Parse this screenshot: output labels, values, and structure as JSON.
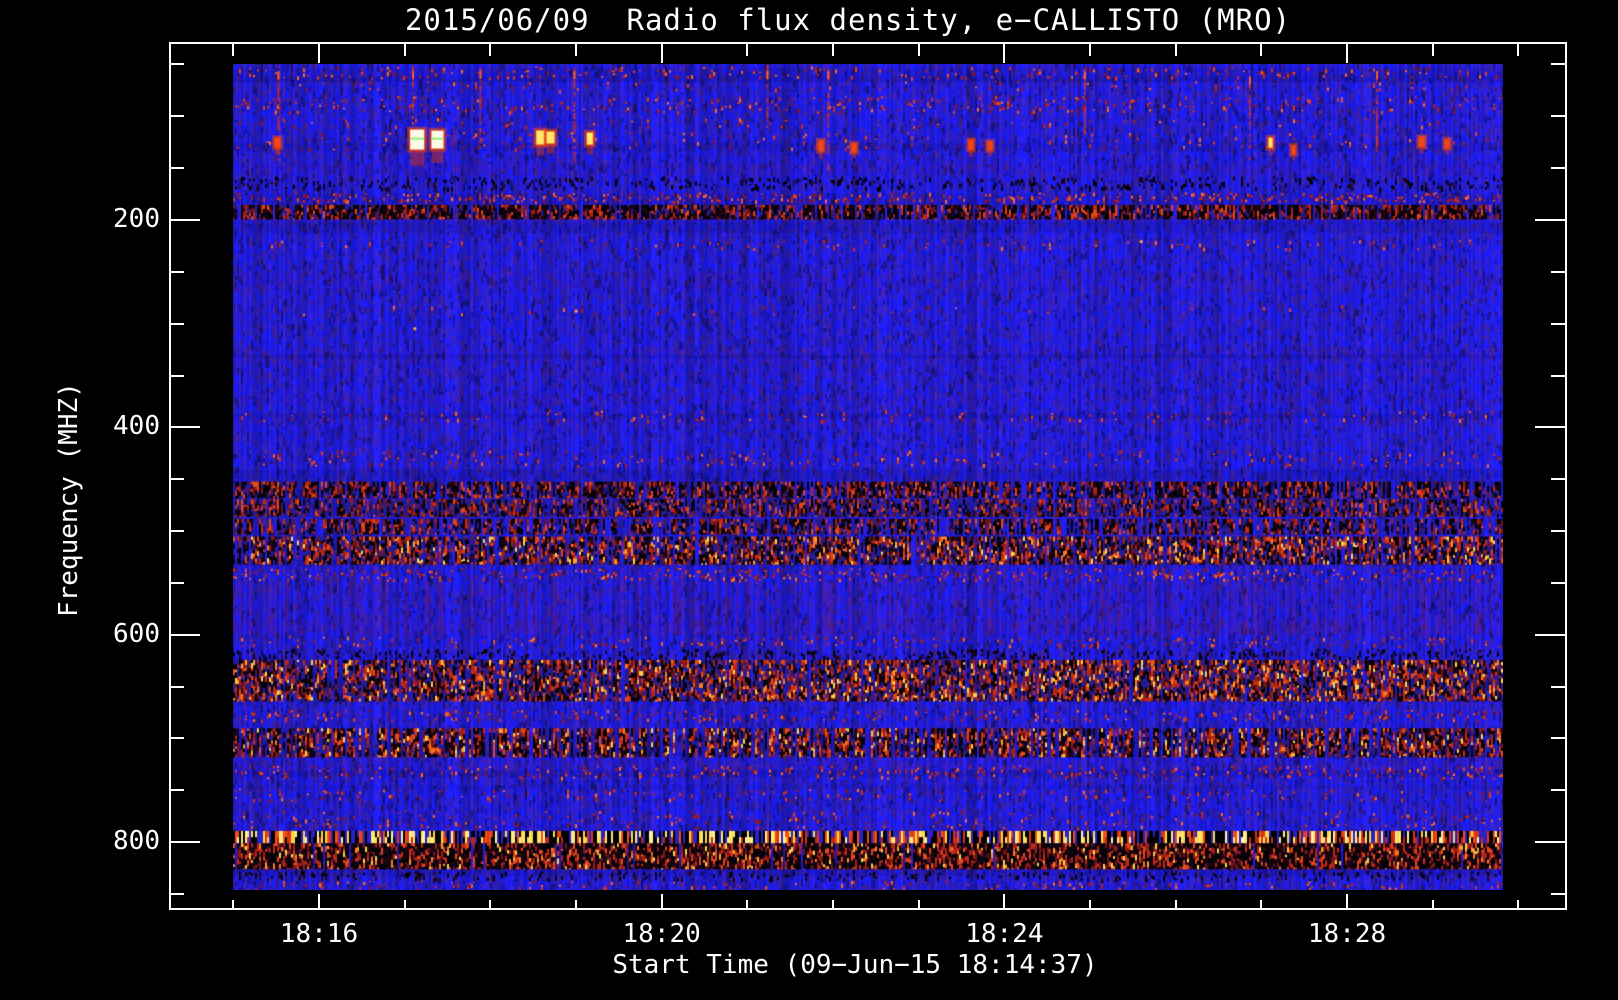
{
  "window": {
    "background": "#000000",
    "foreground": "#ffffff"
  },
  "chart_data": {
    "type": "heatmap",
    "subtype": "radio-spectrogram",
    "title": "2015/06/09  Radio flux density, e−CALLISTO (MRO)",
    "xlabel": "Start Time (09−Jun−15 18:14:37)",
    "ylabel": "Frequency (MHZ)",
    "date": "2015/06/09",
    "instrument": "e-CALLISTO (MRO)",
    "start_time": "18:14:37",
    "x_axis": {
      "major_tick_labels": [
        "18:16",
        "18:20",
        "18:24",
        "18:28"
      ],
      "major_step_minutes": 4,
      "minor_step_minutes": 1,
      "range": [
        "18:14:37",
        "18:30:55"
      ]
    },
    "y_axis": {
      "major_tick_values": [
        200,
        400,
        600,
        800
      ],
      "minor_step_mhz": 50,
      "tick_range_mhz": [
        50,
        850
      ],
      "direction": "increasing-downward",
      "image_range_mhz": [
        49,
        846
      ]
    },
    "legend": "none",
    "grid": false,
    "colormap": "blue background, red/black interference bands, yellow-white saturated bursts",
    "palette": {
      "base_blue": "#1c1cee",
      "indigo": "#341b9e",
      "dark_blue": "#19127e",
      "reds": [
        "#8c1420",
        "#b02018",
        "#cf3014",
        "#e84414",
        "#ff6a22"
      ],
      "heavy_reds": [
        "#701414",
        "#a32012",
        "#c82a10",
        "#e84814"
      ],
      "bright_orange": [
        "#ff7a1e",
        "#ffa428",
        "#ffd34a"
      ],
      "yellows": [
        "#ffd84a",
        "#ffe97c",
        "#fff4ad"
      ],
      "dark_speckle": [
        "#000000",
        "#0d0306",
        "#1c060c"
      ],
      "blob_core_white": "#fffbe8",
      "blob_green_tinge": "#92ee7e"
    },
    "bands": [
      {
        "f0": 50,
        "f1": 63,
        "type": "speckle",
        "shade": "red",
        "intensity": 0.3
      },
      {
        "f0": 64,
        "f1": 75,
        "type": "speckle",
        "shade": "red",
        "intensity": 0.12
      },
      {
        "f0": 78,
        "f1": 97,
        "type": "speckle",
        "shade": "red",
        "intensity": 0.4
      },
      {
        "f0": 100,
        "f1": 110,
        "type": "speckle",
        "shade": "red",
        "intensity": 0.1
      },
      {
        "f0": 112,
        "f1": 133,
        "type": "speckle",
        "shade": "red",
        "intensity": 0.16
      },
      {
        "f0": 156,
        "f1": 170,
        "type": "speckle",
        "shade": "dark",
        "intensity": 0.45
      },
      {
        "f0": 172,
        "f1": 182,
        "type": "speckle",
        "shade": "red",
        "intensity": 0.5
      },
      {
        "f0": 185,
        "f1": 199,
        "type": "heavy",
        "dark": 0.55,
        "intensity": 0.9,
        "bright": false
      },
      {
        "f0": 217,
        "f1": 228,
        "type": "speckle",
        "shade": "red",
        "intensity": 0.14
      },
      {
        "f0": 280,
        "f1": 292,
        "type": "speckle",
        "shade": "red",
        "intensity": 0.05
      },
      {
        "f0": 382,
        "f1": 394,
        "type": "speckle",
        "shade": "red",
        "intensity": 0.16
      },
      {
        "f0": 420,
        "f1": 438,
        "type": "speckle",
        "shade": "red",
        "intensity": 0.28
      },
      {
        "f0": 452,
        "f1": 468,
        "type": "heavy",
        "dark": 0.5,
        "intensity": 0.75,
        "bright": false
      },
      {
        "f0": 469,
        "f1": 486,
        "type": "heavy",
        "dark": 0.32,
        "intensity": 0.8,
        "bright": false
      },
      {
        "f0": 488,
        "f1": 503,
        "type": "heavy",
        "dark": 0.45,
        "intensity": 0.7,
        "bright": false
      },
      {
        "f0": 505,
        "f1": 532,
        "type": "heavy",
        "dark": 0.34,
        "intensity": 0.88,
        "bright": true
      },
      {
        "f0": 534,
        "f1": 548,
        "type": "speckle",
        "shade": "red",
        "intensity": 0.5
      },
      {
        "f0": 548,
        "f1": 600,
        "type": "stripes",
        "intensity": 0.3
      },
      {
        "f0": 600,
        "f1": 612,
        "type": "speckle",
        "shade": "red",
        "intensity": 0.25
      },
      {
        "f0": 612,
        "f1": 623,
        "type": "speckle",
        "shade": "dark",
        "intensity": 0.4
      },
      {
        "f0": 624,
        "f1": 664,
        "type": "heavy",
        "dark": 0.3,
        "intensity": 0.92,
        "bright": true
      },
      {
        "f0": 671,
        "f1": 683,
        "type": "speckle",
        "shade": "red",
        "intensity": 0.35
      },
      {
        "f0": 690,
        "f1": 718,
        "type": "heavy",
        "dark": 0.42,
        "intensity": 0.72,
        "bright": true
      },
      {
        "f0": 724,
        "f1": 739,
        "type": "speckle",
        "shade": "red",
        "intensity": 0.42
      },
      {
        "f0": 747,
        "f1": 760,
        "type": "speckle",
        "shade": "red",
        "intensity": 0.2
      },
      {
        "f0": 767,
        "f1": 788,
        "type": "speckle",
        "shade": "red",
        "intensity": 0.3
      },
      {
        "f0": 789,
        "f1": 801,
        "type": "yellowdash",
        "intensity": 0.9
      },
      {
        "f0": 801,
        "f1": 826,
        "type": "heavy",
        "dark": 0.6,
        "intensity": 0.95,
        "bright": true
      },
      {
        "f0": 826,
        "f1": 836,
        "type": "speckle",
        "shade": "dark",
        "intensity": 0.35
      },
      {
        "f0": 836,
        "f1": 845,
        "type": "speckle",
        "shade": "red",
        "intensity": 0.18
      }
    ],
    "events": {
      "streaks": [
        {
          "t": 0.035,
          "f0": 50,
          "f1": 140
        },
        {
          "t": 0.141,
          "f0": 50,
          "f1": 120
        },
        {
          "t": 0.194,
          "f0": 50,
          "f1": 130
        },
        {
          "t": 0.268,
          "f0": 50,
          "f1": 145
        },
        {
          "t": 0.42,
          "f0": 50,
          "f1": 110
        },
        {
          "t": 0.468,
          "f0": 50,
          "f1": 150
        },
        {
          "t": 0.67,
          "f0": 50,
          "f1": 115
        },
        {
          "t": 0.8,
          "f0": 55,
          "f1": 140
        },
        {
          "t": 0.9,
          "f0": 50,
          "f1": 135
        }
      ],
      "blobs": [
        {
          "t": 0.145,
          "f": 122,
          "w": 14,
          "h": 20,
          "core": "white"
        },
        {
          "t": 0.161,
          "f": 122,
          "w": 12,
          "h": 18,
          "core": "white"
        },
        {
          "t": 0.242,
          "f": 120,
          "w": 8,
          "h": 14,
          "core": "yellow"
        },
        {
          "t": 0.25,
          "f": 120,
          "w": 8,
          "h": 12,
          "core": "yellow"
        },
        {
          "t": 0.281,
          "f": 121,
          "w": 6,
          "h": 12,
          "core": "yellow"
        },
        {
          "t": 0.035,
          "f": 125,
          "w": 5,
          "h": 9,
          "core": "red"
        },
        {
          "t": 0.463,
          "f": 128,
          "w": 4,
          "h": 10,
          "core": "red"
        },
        {
          "t": 0.489,
          "f": 130,
          "w": 4,
          "h": 8,
          "core": "red"
        },
        {
          "t": 0.581,
          "f": 127,
          "w": 4,
          "h": 9,
          "core": "red"
        },
        {
          "t": 0.596,
          "f": 128,
          "w": 4,
          "h": 8,
          "core": "red"
        },
        {
          "t": 0.817,
          "f": 125,
          "w": 4,
          "h": 10,
          "core": "yellow"
        },
        {
          "t": 0.835,
          "f": 132,
          "w": 3,
          "h": 8,
          "core": "red"
        },
        {
          "t": 0.936,
          "f": 124,
          "w": 5,
          "h": 9,
          "core": "red"
        },
        {
          "t": 0.956,
          "f": 126,
          "w": 4,
          "h": 8,
          "core": "red"
        }
      ],
      "dots": [
        {
          "t": 0.269,
          "f": 286
        },
        {
          "t": 0.142,
          "f": 303
        },
        {
          "t": 0.714,
          "f": 219
        }
      ]
    }
  }
}
